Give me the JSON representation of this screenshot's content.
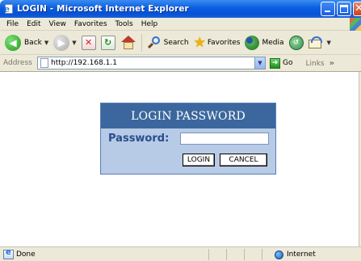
{
  "window": {
    "title": "LOGIN - Microsoft Internet Explorer",
    "controls": [
      "minimize",
      "maximize",
      "close"
    ]
  },
  "menubar": {
    "items": [
      "File",
      "Edit",
      "View",
      "Favorites",
      "Tools",
      "Help"
    ]
  },
  "toolbar": {
    "back_label": "Back",
    "search_label": "Search",
    "favorites_label": "Favorites",
    "media_label": "Media"
  },
  "addressbar": {
    "label": "Address",
    "url": "http://192.168.1.1",
    "go_label": "Go",
    "links_label": "Links",
    "more": "»"
  },
  "login": {
    "header": "LOGIN PASSWORD",
    "password_label": "Password:",
    "password_value": "",
    "login_button": "LOGIN",
    "cancel_button": "CANCEL"
  },
  "statusbar": {
    "status": "Done",
    "zone": "Internet"
  },
  "colors": {
    "titlebar": "#0a5ee0",
    "chrome": "#ece9d8",
    "login_header": "#3b679e",
    "login_body": "#b7cbe6",
    "password_label": "#2a4c8c"
  }
}
